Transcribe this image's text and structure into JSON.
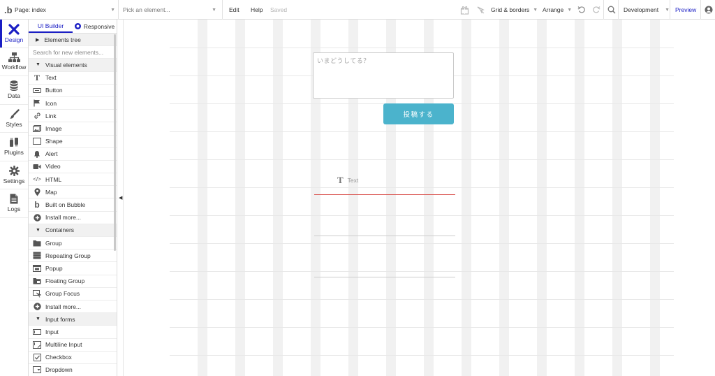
{
  "topbar": {
    "logo": ".b",
    "page_label": "Page: index",
    "element_picker_placeholder": "Pick an element...",
    "menu_edit": "Edit",
    "menu_help": "Help",
    "saved_status": "Saved",
    "grid_borders": "Grid & borders",
    "arrange": "Arrange",
    "environment": "Development",
    "preview": "Preview"
  },
  "sidebar": {
    "items": [
      {
        "label": "Design",
        "icon": "design-icon"
      },
      {
        "label": "Workflow",
        "icon": "workflow-icon"
      },
      {
        "label": "Data",
        "icon": "database-icon"
      },
      {
        "label": "Styles",
        "icon": "brush-icon"
      },
      {
        "label": "Plugins",
        "icon": "plug-icon"
      },
      {
        "label": "Settings",
        "icon": "gear-icon"
      },
      {
        "label": "Logs",
        "icon": "document-icon"
      }
    ]
  },
  "panel": {
    "tab_ui_builder": "UI Builder",
    "tab_responsive": "Responsive",
    "elements_tree": "Elements tree",
    "search_placeholder": "Search for new elements...",
    "section_visual": "Visual elements",
    "visual_items": [
      "Text",
      "Button",
      "Icon",
      "Link",
      "Image",
      "Shape",
      "Alert",
      "Video",
      "HTML",
      "Map",
      "Built on Bubble",
      "Install more..."
    ],
    "section_containers": "Containers",
    "container_items": [
      "Group",
      "Repeating Group",
      "Popup",
      "Floating Group",
      "Group Focus",
      "Install more..."
    ],
    "section_input": "Input forms",
    "input_items": [
      "Input",
      "Multiline Input",
      "Checkbox",
      "Dropdown"
    ]
  },
  "canvas": {
    "multiline_placeholder": "いまどうしてる？",
    "post_button": "投稿する",
    "text_element": "Text"
  },
  "colors": {
    "accent": "#1a1ec4",
    "button": "#4bb3cc",
    "red_line": "#d9534f"
  }
}
